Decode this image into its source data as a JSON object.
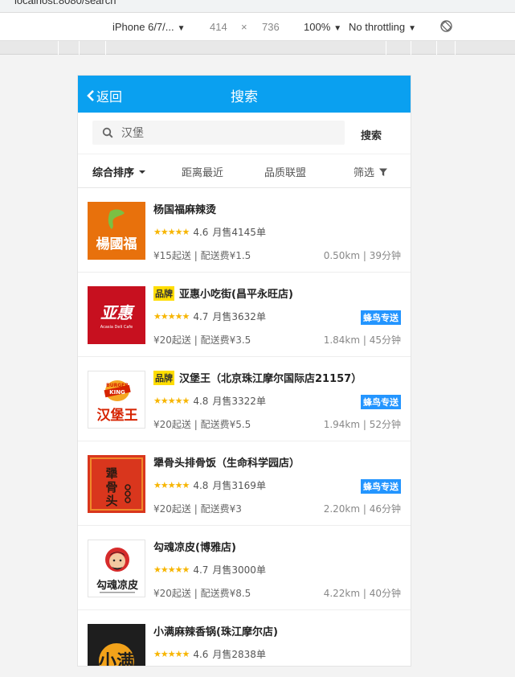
{
  "browser": {
    "url": "localhost:8080/search",
    "device": "iPhone 6/7/...",
    "width": "414",
    "times": "×",
    "height": "736",
    "zoom": "100%",
    "throttle": "No throttling"
  },
  "header": {
    "back_label": "返回",
    "title": "搜索"
  },
  "search": {
    "value": "汉堡",
    "button": "搜索"
  },
  "sort": {
    "default_label": "综合排序",
    "distance_label": "距离最近",
    "quality_label": "品质联盟",
    "filter_label": "筛选"
  },
  "colors": {
    "accent": "#0aa0f0",
    "star": "#f7b500",
    "brand_tag": "#ffdd00",
    "fengniao_tag": "#2395ff"
  },
  "shops": [
    {
      "name": "杨国福麻辣烫",
      "brand": "",
      "stars": "★★★★★",
      "rating": "4.6",
      "sales": "月售4145单",
      "fee": "¥15起送 | 配送费¥1.5",
      "distance": "0.50km | 39分钟",
      "fengniao": "",
      "logo_text": "楊國福",
      "logo_icon": "yangguofu-logo"
    },
    {
      "name": "亚惠小吃街(昌平永旺店)",
      "brand": "品牌",
      "stars": "★★★★★",
      "rating": "4.7",
      "sales": "月售3632单",
      "fee": "¥20起送 | 配送费¥3.5",
      "distance": "1.84km | 45分钟",
      "fengniao": "蜂鸟专送",
      "logo_text": "亚惠",
      "logo_sub": "Acasia Deli Cafe",
      "logo_icon": "yahui-logo"
    },
    {
      "name": "汉堡王（北京珠江摩尔国际店21157）",
      "brand": "品牌",
      "stars": "★★★★★",
      "rating": "4.8",
      "sales": "月售3322单",
      "fee": "¥20起送 | 配送费¥5.5",
      "distance": "1.94km | 52分钟",
      "fengniao": "蜂鸟专送",
      "logo_text": "汉堡王",
      "logo_top": "BURGER",
      "logo_mid": "KING",
      "logo_icon": "burger-king-logo"
    },
    {
      "name": "犟骨头排骨饭（生命科学园店）",
      "brand": "",
      "stars": "★★★★★",
      "rating": "4.8",
      "sales": "月售3169单",
      "fee": "¥20起送 | 配送费¥3",
      "distance": "2.20km | 46分钟",
      "fengniao": "蜂鸟专送",
      "logo_text": "犟骨头",
      "logo_icon": "jianggutou-logo"
    },
    {
      "name": "勾魂凉皮(博雅店)",
      "brand": "",
      "stars": "★★★★★",
      "rating": "4.7",
      "sales": "月售3000单",
      "fee": "¥20起送 | 配送费¥8.5",
      "distance": "4.22km | 40分钟",
      "fengniao": "",
      "logo_text": "勾魂凉皮",
      "logo_icon": "gouhun-logo"
    },
    {
      "name": "小满麻辣香锅(珠江摩尔店)",
      "brand": "",
      "stars": "★★★★★",
      "rating": "4.6",
      "sales": "月售2838单",
      "fee": "",
      "distance": "",
      "fengniao": "",
      "logo_text": "小满",
      "logo_icon": "xiaoman-logo"
    }
  ]
}
